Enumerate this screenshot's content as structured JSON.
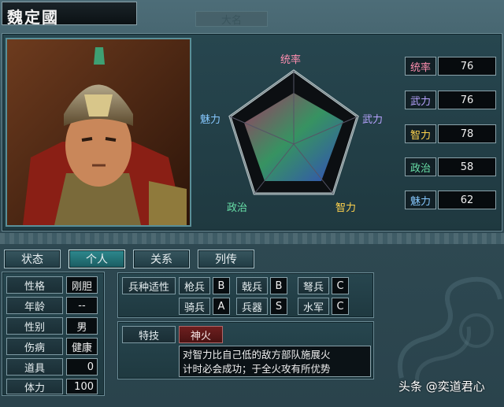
{
  "header": {
    "name": "魏定國",
    "faint_label": "大名"
  },
  "radar": {
    "labels": [
      "统率",
      "武力",
      "智力",
      "政治",
      "魅力"
    ]
  },
  "stats": [
    {
      "label": "统率",
      "value": "76",
      "color": "#ff8fb0"
    },
    {
      "label": "武力",
      "value": "76",
      "color": "#b7a3ff"
    },
    {
      "label": "智力",
      "value": "78",
      "color": "#ffd34d"
    },
    {
      "label": "政治",
      "value": "58",
      "color": "#68e0a8"
    },
    {
      "label": "魅力",
      "value": "62",
      "color": "#86c8ff"
    }
  ],
  "tabs": [
    "状态",
    "个人",
    "关系",
    "列传"
  ],
  "active_tab": "个人",
  "personal": [
    {
      "label": "性格",
      "value": "刚胆"
    },
    {
      "label": "年龄",
      "value": "--"
    },
    {
      "label": "性别",
      "value": "男"
    },
    {
      "label": "伤病",
      "value": "健康"
    },
    {
      "label": "道具",
      "value": "0"
    },
    {
      "label": "体力",
      "value": "100"
    }
  ],
  "aptitude": {
    "header": "兵种适性",
    "rows": [
      [
        {
          "unit": "枪兵",
          "grade": "B"
        },
        {
          "unit": "戟兵",
          "grade": "B"
        },
        {
          "unit": "弩兵",
          "grade": "C"
        }
      ],
      [
        {
          "unit": "骑兵",
          "grade": "A"
        },
        {
          "unit": "兵器",
          "grade": "S"
        },
        {
          "unit": "水军",
          "grade": "C"
        }
      ]
    ]
  },
  "skill": {
    "label": "特技",
    "name": "神火",
    "description_line1": "对智力比自己低的敌方部队施展火",
    "description_line2": "计时必会成功；于全火攻有所优势"
  },
  "watermark": "头条 @奕道君心"
}
